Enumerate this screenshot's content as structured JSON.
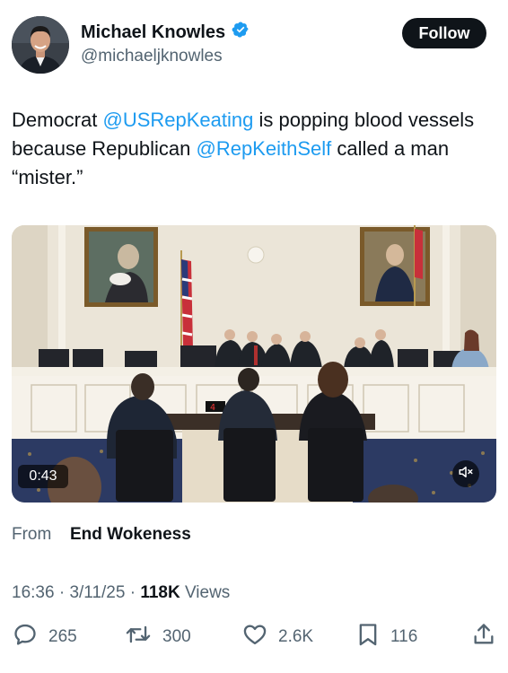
{
  "author": {
    "name": "Michael Knowles",
    "handle": "@michaeljknowles",
    "verified": true,
    "verified_color": "#1d9bf0"
  },
  "follow_label": "Follow",
  "tweet": {
    "part1": "Democrat ",
    "mention1": "@USRepKeating",
    "part2": " is popping blood vessels because Republican ",
    "mention2": "@RepKeithSelf",
    "part3": " called a man “mister.”",
    "mention_color": "#1d9bf0"
  },
  "video": {
    "duration": "0:43",
    "screen_readout": "4"
  },
  "source": {
    "prefix": "From",
    "name": "End Wokeness"
  },
  "meta": {
    "time": "16:36",
    "sep1": " · ",
    "date": "3/11/25",
    "sep2": " · ",
    "views_count": "118K",
    "views_label": " Views"
  },
  "actions": {
    "replies": "265",
    "reposts": "300",
    "likes": "2.6K",
    "bookmarks": "116"
  },
  "icons": [
    "verified-badge-icon",
    "reply-icon",
    "repost-icon",
    "like-icon",
    "bookmark-icon",
    "share-icon",
    "mute-icon"
  ]
}
